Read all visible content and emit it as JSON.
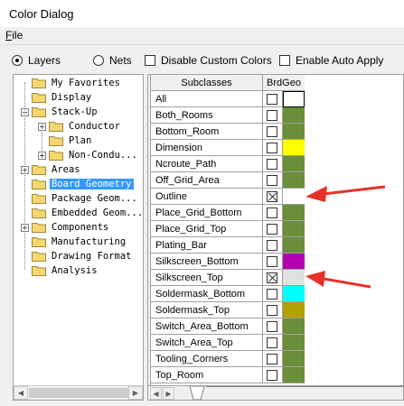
{
  "window": {
    "title": "Color Dialog"
  },
  "menu": {
    "file_accel": "F",
    "file_rest": "ile"
  },
  "options": {
    "layers": {
      "label": "Layers",
      "selected": true
    },
    "nets": {
      "label": "Nets",
      "selected": false
    },
    "disable_custom_colors": {
      "label": "Disable Custom Colors",
      "checked": false
    },
    "enable_auto_apply": {
      "label": "Enable Auto Apply",
      "checked": false
    }
  },
  "tree": [
    {
      "label": "My Favorites",
      "level": 1,
      "expander": ""
    },
    {
      "label": "Display",
      "level": 1,
      "expander": ""
    },
    {
      "label": "Stack-Up",
      "level": 1,
      "expander": "−"
    },
    {
      "label": "Conductor",
      "level": 2,
      "expander": "+"
    },
    {
      "label": "Plan",
      "level": 2,
      "expander": ""
    },
    {
      "label": "Non-Condu...",
      "level": 2,
      "expander": "+"
    },
    {
      "label": "Areas",
      "level": 1,
      "expander": "+"
    },
    {
      "label": "Board Geometry",
      "level": 1,
      "expander": "",
      "selected": true
    },
    {
      "label": "Package Geom...",
      "level": 1,
      "expander": ""
    },
    {
      "label": "Embedded Geom...",
      "level": 1,
      "expander": ""
    },
    {
      "label": "Components",
      "level": 1,
      "expander": "+"
    },
    {
      "label": "Manufacturing",
      "level": 1,
      "expander": ""
    },
    {
      "label": "Drawing Format",
      "level": 1,
      "expander": ""
    },
    {
      "label": "Analysis",
      "level": 1,
      "expander": ""
    }
  ],
  "table": {
    "headers": {
      "subclasses": "Subclasses",
      "brdgeo": "BrdGeo"
    },
    "rows": [
      {
        "name": "All",
        "checked": false,
        "color": "#ffffff"
      },
      {
        "name": "Both_Rooms",
        "checked": false,
        "color": "#6b8e3a"
      },
      {
        "name": "Bottom_Room",
        "checked": false,
        "color": "#6b8e3a"
      },
      {
        "name": "Dimension",
        "checked": false,
        "color": "#ffff00"
      },
      {
        "name": "Ncroute_Path",
        "checked": false,
        "color": "#6b8e3a"
      },
      {
        "name": "Off_Grid_Area",
        "checked": false,
        "color": "#6b8e3a"
      },
      {
        "name": "Outline",
        "checked": true,
        "color": "#ffffff"
      },
      {
        "name": "Place_Grid_Bottom",
        "checked": false,
        "color": "#6b8e3a"
      },
      {
        "name": "Place_Grid_Top",
        "checked": false,
        "color": "#6b8e3a"
      },
      {
        "name": "Plating_Bar",
        "checked": false,
        "color": "#6b8e3a"
      },
      {
        "name": "Silkscreen_Bottom",
        "checked": false,
        "color": "#b000b0"
      },
      {
        "name": "Silkscreen_Top",
        "checked": true,
        "color": "#e0e0e0"
      },
      {
        "name": "Soldermask_Bottom",
        "checked": false,
        "color": "#00ffff"
      },
      {
        "name": "Soldermask_Top",
        "checked": false,
        "color": "#b0a000"
      },
      {
        "name": "Switch_Area_Bottom",
        "checked": false,
        "color": "#6b8e3a"
      },
      {
        "name": "Switch_Area_Top",
        "checked": false,
        "color": "#6b8e3a"
      },
      {
        "name": "Tooling_Corners",
        "checked": false,
        "color": "#6b8e3a"
      },
      {
        "name": "Top_Room",
        "checked": false,
        "color": "#6b8e3a"
      }
    ]
  },
  "colors": {
    "annotation_arrow": "#e8302a",
    "selection": "#3399ff"
  }
}
